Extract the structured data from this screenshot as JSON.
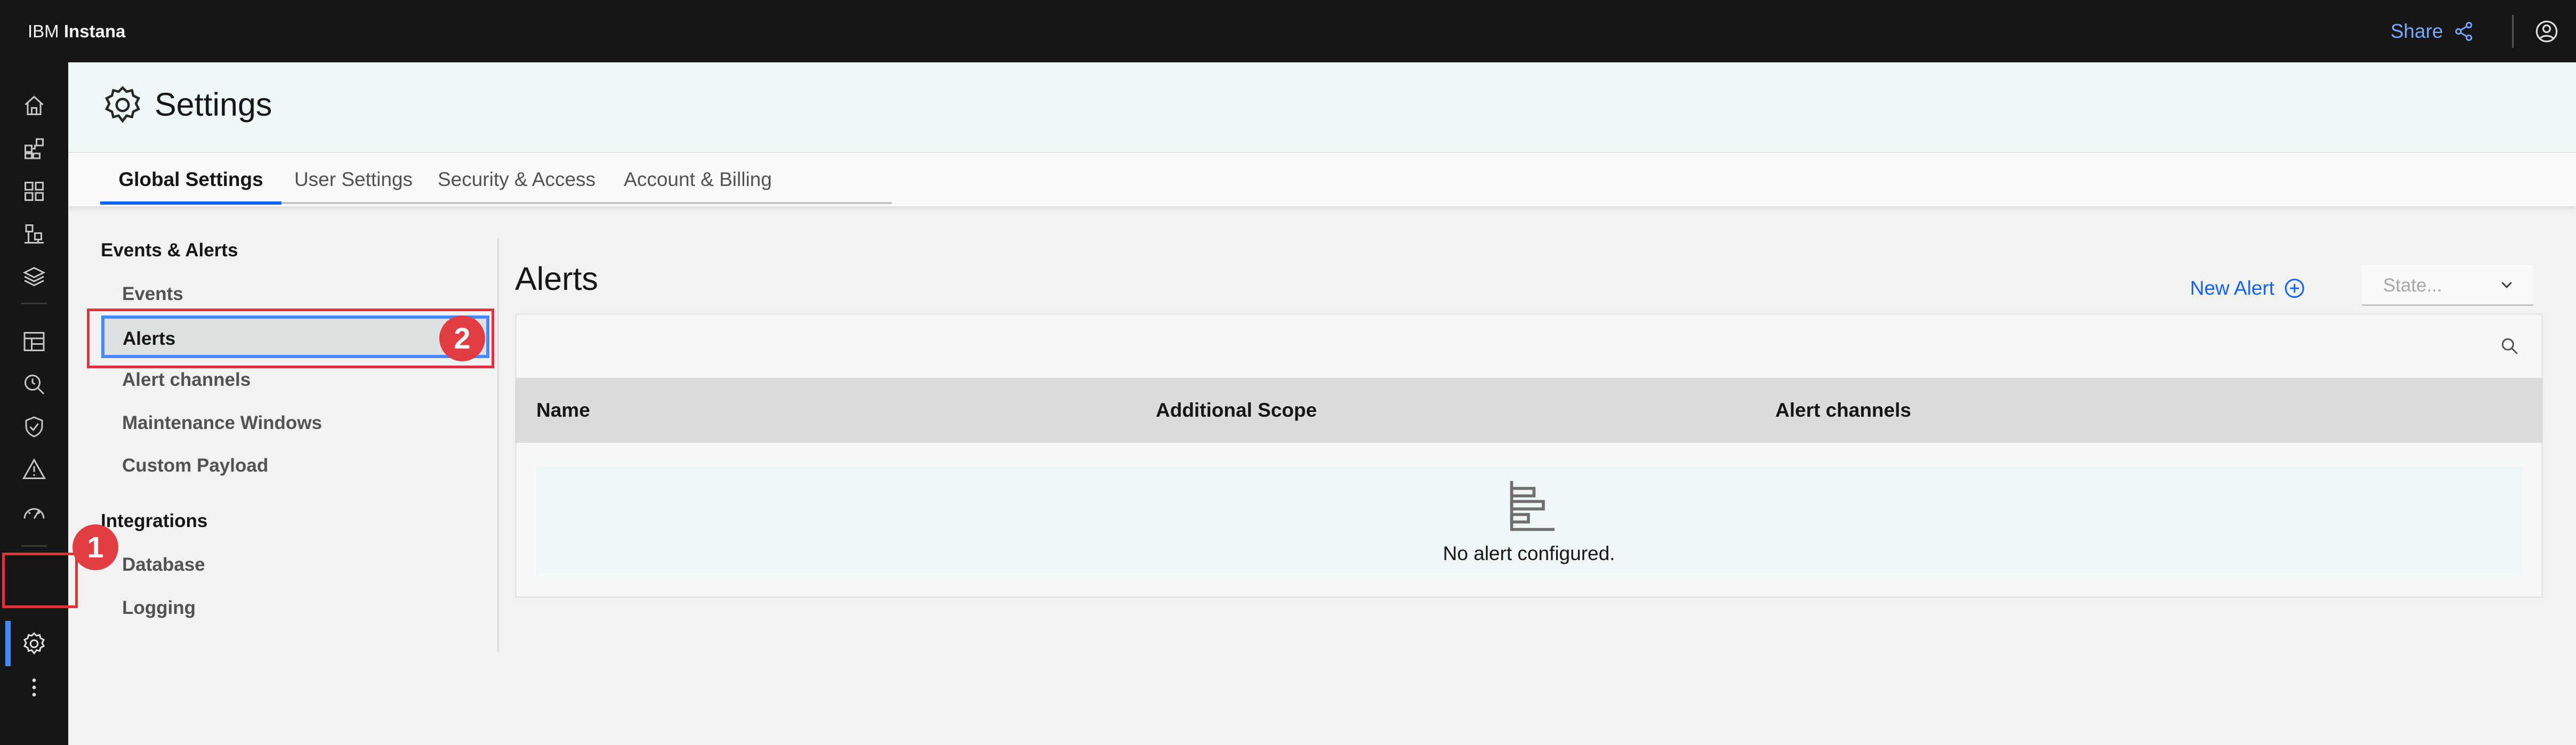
{
  "app": {
    "brand_prefix": "IBM",
    "brand_name": "Instana"
  },
  "topbar": {
    "share_label": "Share"
  },
  "sidebar": {
    "icons": [
      "home-icon",
      "application-icon",
      "platform-icon",
      "infrastructure-icon",
      "layers-icon",
      "dashboard-icon",
      "analyze-icon",
      "security-icon",
      "alert-warning-icon",
      "performance-icon",
      "settings-icon",
      "more-icon"
    ],
    "active": "settings-icon"
  },
  "page": {
    "title": "Settings"
  },
  "tabs": [
    {
      "label": "Global Settings",
      "active": true
    },
    {
      "label": "User Settings",
      "active": false
    },
    {
      "label": "Security & Access",
      "active": false
    },
    {
      "label": "Account & Billing",
      "active": false
    }
  ],
  "menu": {
    "sections": [
      {
        "title": "Events & Alerts",
        "items": [
          "Events",
          "Alerts",
          "Alert channels",
          "Maintenance Windows",
          "Custom Payload"
        ]
      },
      {
        "title": "Integrations",
        "items": [
          "Database",
          "Logging"
        ]
      }
    ],
    "selected": "Alerts"
  },
  "callouts": [
    "1",
    "2"
  ],
  "content": {
    "title": "Alerts",
    "new_alert_label": "New Alert",
    "state_placeholder": "State...",
    "columns": [
      "Name",
      "Additional Scope",
      "Alert channels"
    ],
    "empty_message": "No alert configured."
  },
  "colors": {
    "accent": "#0f62fe",
    "link": "#78a9ff",
    "callout": "#e1313a",
    "topbar": "#161616"
  }
}
